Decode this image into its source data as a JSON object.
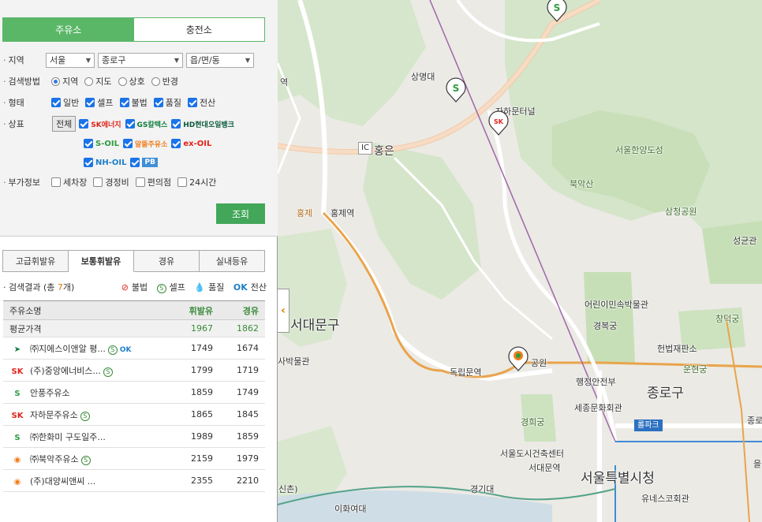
{
  "main_tabs": [
    "주유소",
    "충전소"
  ],
  "filters": {
    "region": {
      "label": "지역",
      "sido": "서울",
      "sigungu": "종로구",
      "dong": "읍/면/동"
    },
    "method": {
      "label": "검색방법",
      "options": [
        "지역",
        "지도",
        "상호",
        "반경"
      ],
      "selected": "지역"
    },
    "type": {
      "label": "형태",
      "options": [
        "일반",
        "셀프",
        "불법",
        "품질",
        "전산"
      ]
    },
    "brand": {
      "label": "상표",
      "all_button": "전체",
      "brands": [
        "SK에너지",
        "GS칼텍스",
        "HD현대오일뱅크",
        "S-OIL",
        "알뜰주유소",
        "ex-OIL",
        "NH-OIL",
        "PB"
      ]
    },
    "extra": {
      "label": "부가정보",
      "options": [
        "세차장",
        "경정비",
        "편의점",
        "24시간"
      ]
    }
  },
  "search_button": "조회",
  "fuel_tabs": [
    "고급휘발유",
    "보통휘발유",
    "경유",
    "실내등유"
  ],
  "active_fuel_tab": "보통휘발유",
  "result": {
    "label_prefix": "검색결과 (총 ",
    "count": "7",
    "label_suffix": "개)",
    "legend": [
      "불법",
      "셀프",
      "품질",
      "전산"
    ]
  },
  "table": {
    "headers": {
      "name": "주유소명",
      "gasoline": "휘발유",
      "diesel": "경유"
    },
    "average": {
      "name": "평균가격",
      "gasoline": "1967",
      "diesel": "1862"
    },
    "rows": [
      {
        "brand": "HD",
        "name": "㈜지에스이앤알 평...",
        "gasoline": "1749",
        "diesel": "1674",
        "badges": [
          "S",
          "전산"
        ]
      },
      {
        "brand": "SK",
        "name": "(주)중앙에너비스...",
        "gasoline": "1799",
        "diesel": "1719",
        "badges": [
          "S"
        ]
      },
      {
        "brand": "S-OIL",
        "name": "안풍주유소",
        "gasoline": "1859",
        "diesel": "1749",
        "badges": []
      },
      {
        "brand": "SK",
        "name": "자하문주유소",
        "gasoline": "1865",
        "diesel": "1845",
        "badges": [
          "S"
        ]
      },
      {
        "brand": "S-OIL",
        "name": "㈜한화미 구도일주...",
        "gasoline": "1989",
        "diesel": "1859",
        "badges": []
      },
      {
        "brand": "알뜰",
        "name": "㈜북악주유소",
        "gasoline": "2159",
        "diesel": "1979",
        "badges": [
          "S"
        ]
      },
      {
        "brand": "알뜰",
        "name": "(주)대양씨앤씨 ...",
        "gasoline": "2355",
        "diesel": "2210",
        "badges": []
      }
    ]
  },
  "map": {
    "labels": {
      "sangmyeong": "상명대",
      "tunnel": "자하문터널",
      "hongeun_ic": "IC",
      "hongeun": "홍은",
      "fortress": "서울한양도성",
      "bugaksan": "북악산",
      "samcheong": "삼청공원",
      "hongje_small": "홍제",
      "hongje": "홍제역",
      "seodaemun": "서대문구",
      "museum_kids": "어린이민속박물관",
      "gyeongbok": "경복궁",
      "changdeok": "창덕궁",
      "court": "헌법재판소",
      "unhyeon": "운현궁",
      "history_museum": "사박물관",
      "dongnimmun": "독립문역",
      "park": "공원",
      "gov_complex": "행정안전부",
      "jongno": "종로구",
      "sejong": "세종문화회관",
      "gyeonghui": "경희궁",
      "architecture": "서울도시건축센터",
      "seodaemun_stn": "서대문역",
      "seoul_city": "서울특별시청",
      "kyonggi": "경기대",
      "unesco": "유네스코회관",
      "ewha": "이화여대",
      "sinchon": "신촌)",
      "sungkyunkwan": "성균관",
      "yeok": "역",
      "jong": "종로",
      "euljiro": "을",
      "loop": "롤파크"
    }
  },
  "colors": {
    "accent": "#5bb768",
    "button": "#43a75a",
    "price": "#3b8b3b"
  }
}
